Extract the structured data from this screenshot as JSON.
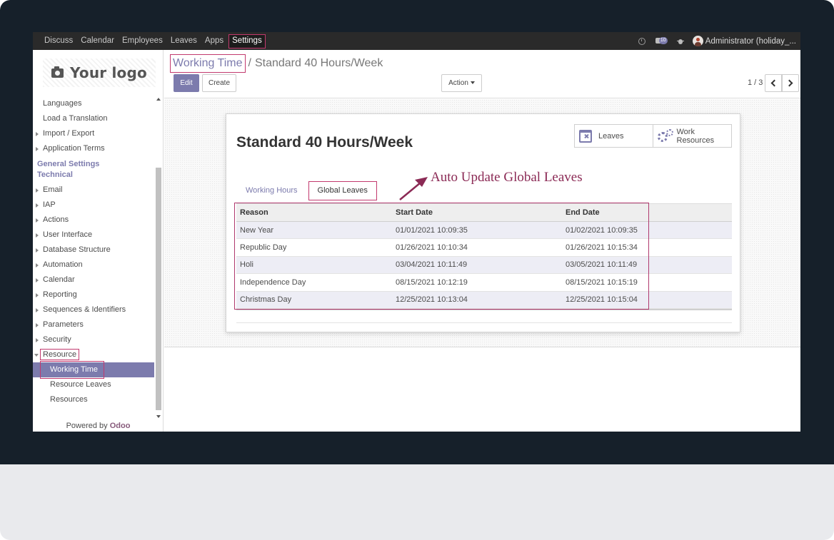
{
  "navbar": {
    "menu": [
      "Discuss",
      "Calendar",
      "Employees",
      "Leaves",
      "Apps",
      "Settings"
    ],
    "active_menu": "Settings",
    "chat_count": "10",
    "user": "Administrator (holiday_..."
  },
  "sidebar": {
    "logo_text": "Your logo",
    "items_top": [
      "Languages",
      "Load a Translation",
      "Import / Export",
      "Application Terms"
    ],
    "header_general": "General Settings",
    "header_technical": "Technical",
    "items_technical": [
      "Email",
      "IAP",
      "Actions",
      "User Interface",
      "Database Structure",
      "Automation",
      "Calendar",
      "Reporting",
      "Sequences & Identifiers",
      "Parameters",
      "Security",
      "Resource"
    ],
    "resource_children": [
      "Working Time",
      "Resource Leaves",
      "Resources"
    ],
    "active_item": "Working Time",
    "powered_by": "Powered by",
    "odoo": "Odoo"
  },
  "control_panel": {
    "breadcrumb_link": "Working Time",
    "breadcrumb_sep": "/",
    "breadcrumb_current": "Standard 40 Hours/Week",
    "edit_label": "Edit",
    "create_label": "Create",
    "action_label": "Action",
    "pager": "1 / 3"
  },
  "form": {
    "title": "Standard 40 Hours/Week",
    "smart_leaves": "Leaves",
    "smart_work_line1": "Work",
    "smart_work_line2": "Resources",
    "tabs": [
      "Working Hours",
      "Global Leaves"
    ],
    "active_tab": "Global Leaves",
    "annotation": "Auto Update Global Leaves",
    "columns": [
      "Reason",
      "Start Date",
      "End Date"
    ],
    "rows": [
      {
        "reason": "New Year",
        "start": "01/01/2021 10:09:35",
        "end": "01/02/2021 10:09:35"
      },
      {
        "reason": "Republic Day",
        "start": "01/26/2021 10:10:34",
        "end": "01/26/2021 10:15:34"
      },
      {
        "reason": "Holi",
        "start": "03/04/2021 10:11:49",
        "end": "03/05/2021 10:11:49"
      },
      {
        "reason": "Independence Day",
        "start": "08/15/2021 10:12:19",
        "end": "08/15/2021 10:15:19"
      },
      {
        "reason": "Christmas Day",
        "start": "12/25/2021 10:13:04",
        "end": "12/25/2021 10:15:04"
      }
    ]
  },
  "colors": {
    "accent": "#7c7bad",
    "highlight": "#c2396e",
    "annotation": "#8b2a55",
    "navbar": "#2a2a2a",
    "bezel": "#16202a"
  }
}
